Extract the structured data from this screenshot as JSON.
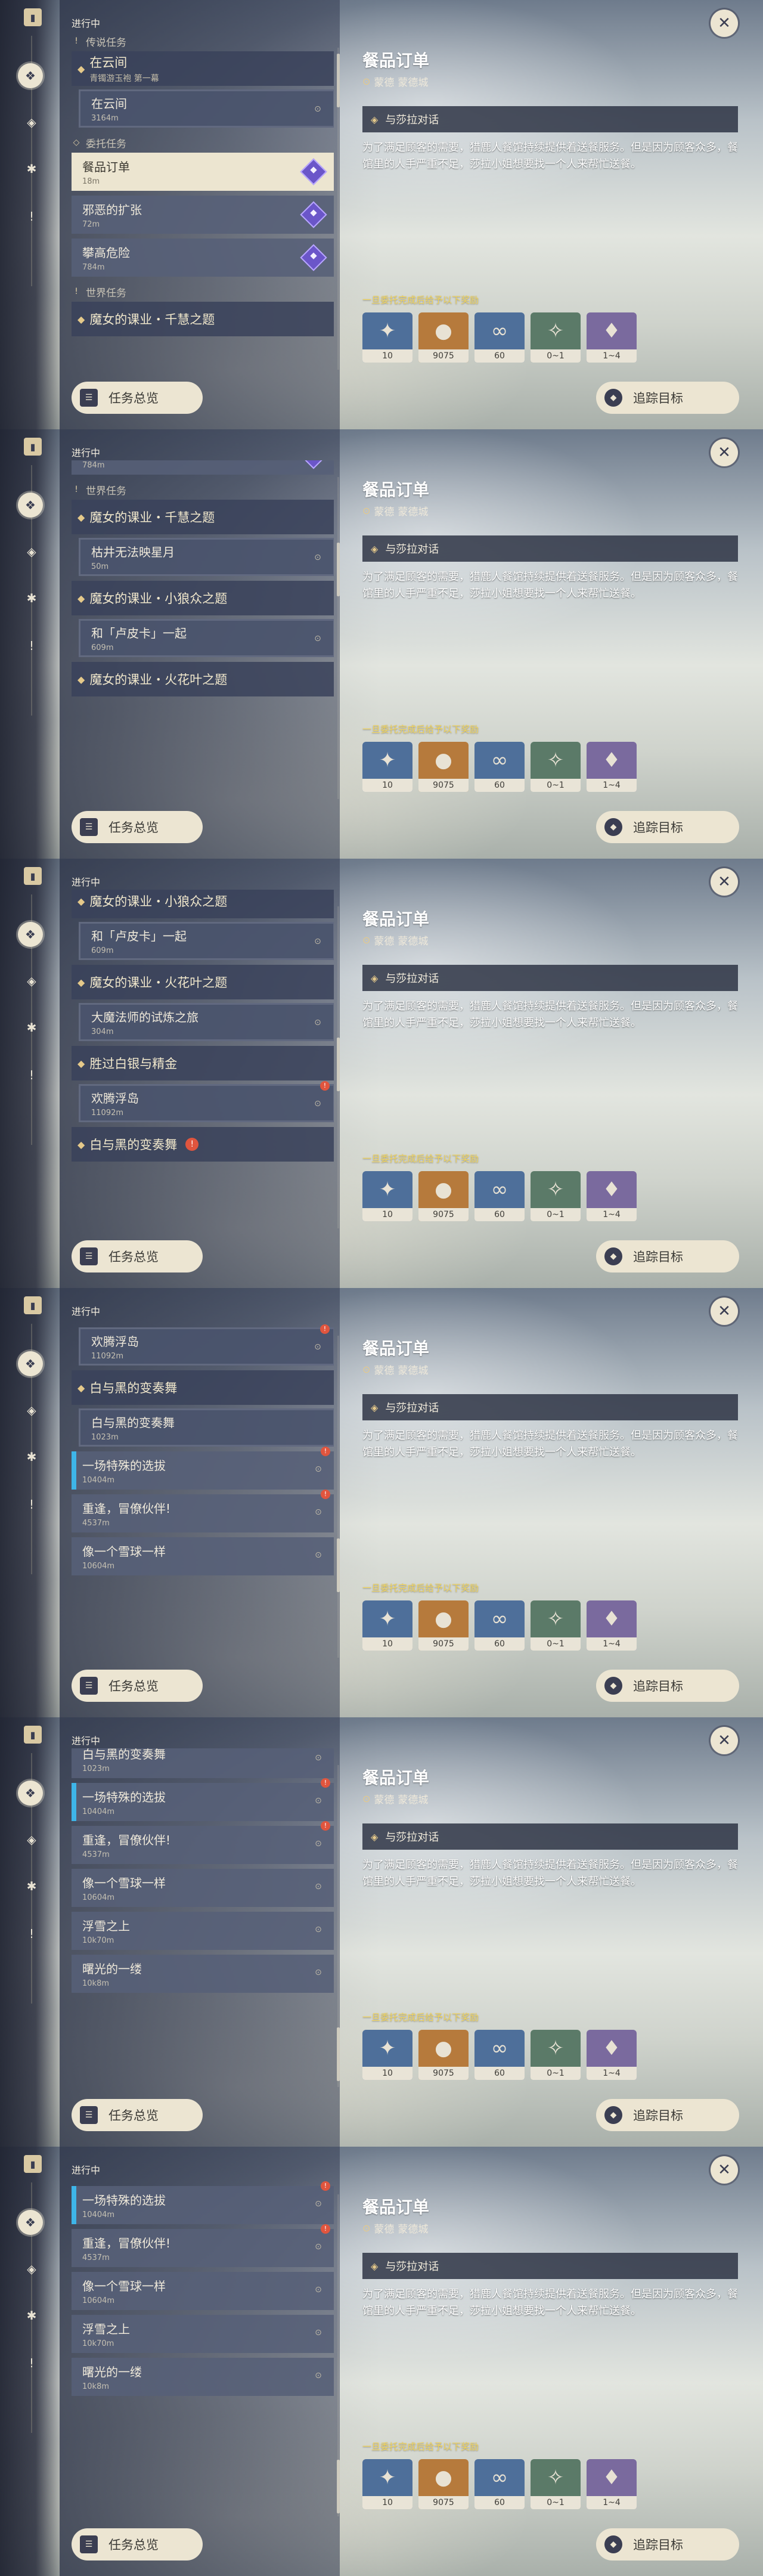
{
  "window": {
    "status_heading": "进行中"
  },
  "sections": {
    "legend": "传说任务",
    "commission": "委托任务",
    "world": "世界任务"
  },
  "groups": {
    "cloud": {
      "title": "在云间",
      "sub": "青镯游玉袍 第一幕"
    },
    "sumeru1": {
      "title": "魔女的课业・千慧之题"
    },
    "sumeru2": {
      "title": "魔女的课业・小狼众之题"
    },
    "sumeru3": {
      "title": "魔女的课业・火花叶之题"
    },
    "silver": {
      "title": "胜过白银与精金"
    },
    "whiteblack": {
      "title": "白与黑的变奏舞"
    }
  },
  "items": {
    "cloud": {
      "name": "在云间",
      "dist": "3164m"
    },
    "order": {
      "name": "餐品订单",
      "dist": "18m"
    },
    "expand": {
      "name": "邪恶的扩张",
      "dist": "72m"
    },
    "climb": {
      "name": "攀高危险",
      "dist": "784m"
    },
    "well": {
      "name": "枯井无法映星月",
      "dist": "50m"
    },
    "puka": {
      "name": "和「卢皮卡」一起",
      "dist": "609m"
    },
    "mage": {
      "name": "大魔法师的试炼之旅",
      "dist": "304m"
    },
    "island": {
      "name": "欢腾浮岛",
      "dist": "11092m"
    },
    "variation": {
      "name": "白与黑的变奏舞",
      "dist": "1023m"
    },
    "special": {
      "name": "一场特殊的选拔",
      "dist": "10404m"
    },
    "reunion": {
      "name": "重逢，冒僚伙伴!",
      "dist": "4537m"
    },
    "snowball": {
      "name": "像一个雪球一样",
      "dist": "10604m"
    },
    "snowtop": {
      "name": "浮雪之上",
      "dist": "10k70m"
    },
    "dawn": {
      "name": "曙光的一缕",
      "dist": "10k8m"
    }
  },
  "buttons": {
    "overview": "任务总览",
    "track": "追踪目标"
  },
  "detail": {
    "title": "餐品订单",
    "location_region": "蒙德",
    "location_city": "蒙德城",
    "objective": "与莎拉对话",
    "description": "为了满足顾客的需要，猎鹿人餐馆持续提供着送餐服务。但是因为顾客众多，餐馆里的人手严重不足，莎拉小姐想要找一个人来帮忙送餐。",
    "rewards_label": "一旦委托完成后给予以下奖励",
    "rewards": [
      {
        "icon": "adventure-exp-icon",
        "count": "10"
      },
      {
        "icon": "mora-icon",
        "count": "9075"
      },
      {
        "icon": "friendship-exp-icon",
        "count": "60"
      },
      {
        "icon": "primogem-icon",
        "count": "0~1"
      },
      {
        "icon": "ore-icon",
        "count": "1~4"
      }
    ]
  },
  "icons": {
    "rail": [
      "quest-book-icon",
      "quest-diamond-icon",
      "compass-icon",
      "flower-icon",
      "alert-icon"
    ],
    "close": "close-icon"
  },
  "colors": {
    "accent": "#ece5d2",
    "reward_text": "#f3d55a",
    "selected": "#ece5d0",
    "alert": "#e0553e",
    "purple": "#6b56c9",
    "blue": "#3eb5e8"
  }
}
